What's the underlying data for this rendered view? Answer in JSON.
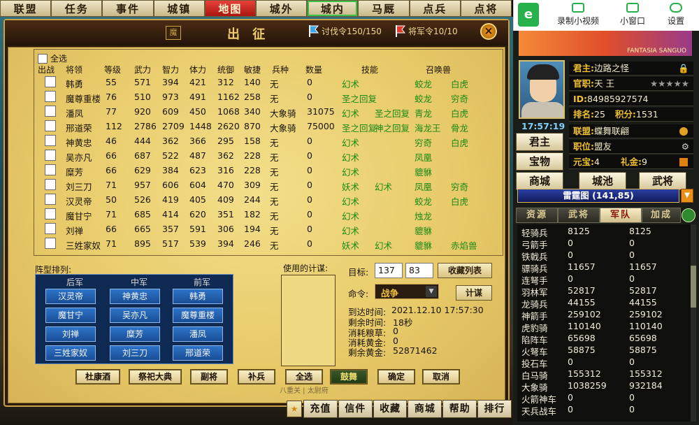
{
  "nav": [
    "联盟",
    "任务",
    "事件",
    "城镇",
    "地图",
    "城外",
    "城内",
    "马厩",
    "点兵",
    "点将"
  ],
  "panel": {
    "title": "出 征",
    "icon": "魔",
    "token1": "讨伐令150/150",
    "token2": "将军令10/10",
    "close": "×"
  },
  "table": {
    "select_all": "全选",
    "headers": [
      "出战",
      "将领",
      "等级",
      "武力",
      "智力",
      "体力",
      "统御",
      "敏捷",
      "兵种",
      "数量",
      "技能",
      "召唤兽"
    ],
    "rows": [
      {
        "name": "韩勇",
        "lv": "55",
        "wl": "571",
        "zl": "394",
        "tl": "421",
        "ty": "312",
        "mj": "140",
        "bz": "无",
        "sl": "0",
        "s1": "幻术",
        "s2": "",
        "z1": "蛟龙",
        "z2": "白虎"
      },
      {
        "name": "魔尊重楼",
        "lv": "76",
        "wl": "510",
        "zl": "973",
        "tl": "491",
        "ty": "1162",
        "mj": "258",
        "bz": "无",
        "sl": "0",
        "s1": "圣之回复",
        "s2": "",
        "z1": "蛟龙",
        "z2": "穷奇"
      },
      {
        "name": "潘凤",
        "lv": "77",
        "wl": "920",
        "zl": "609",
        "tl": "450",
        "ty": "1068",
        "mj": "340",
        "bz": "大象骑",
        "sl": "31075",
        "s1": "幻术",
        "s2": "圣之回复",
        "z1": "青龙",
        "z2": "白虎"
      },
      {
        "name": "邢道荣",
        "lv": "112",
        "wl": "2786",
        "zl": "2709",
        "tl": "1448",
        "ty": "2620",
        "mj": "870",
        "bz": "大象骑",
        "sl": "75000",
        "s1": "圣之回复",
        "s2": "神之回复",
        "z1": "海龙王",
        "z2": "骨龙"
      },
      {
        "name": "神黄忠",
        "lv": "46",
        "wl": "444",
        "zl": "362",
        "tl": "366",
        "ty": "295",
        "mj": "158",
        "bz": "无",
        "sl": "0",
        "s1": "幻术",
        "s2": "",
        "z1": "穷奇",
        "z2": "白虎"
      },
      {
        "name": "吴亦凡",
        "lv": "66",
        "wl": "687",
        "zl": "522",
        "tl": "487",
        "ty": "362",
        "mj": "228",
        "bz": "无",
        "sl": "0",
        "s1": "幻术",
        "s2": "",
        "z1": "凤凰",
        "z2": ""
      },
      {
        "name": "糜芳",
        "lv": "66",
        "wl": "629",
        "zl": "384",
        "tl": "623",
        "ty": "316",
        "mj": "228",
        "bz": "无",
        "sl": "0",
        "s1": "幻术",
        "s2": "",
        "z1": "貔貅",
        "z2": ""
      },
      {
        "name": "刘三刀",
        "lv": "71",
        "wl": "957",
        "zl": "606",
        "tl": "604",
        "ty": "470",
        "mj": "309",
        "bz": "无",
        "sl": "0",
        "s1": "妖术",
        "s2": "幻术",
        "z1": "凤凰",
        "z2": "穷奇"
      },
      {
        "name": "汉灵帝",
        "lv": "50",
        "wl": "526",
        "zl": "419",
        "tl": "405",
        "ty": "409",
        "mj": "244",
        "bz": "无",
        "sl": "0",
        "s1": "幻术",
        "s2": "",
        "z1": "蛟龙",
        "z2": "白虎"
      },
      {
        "name": "魔甘宁",
        "lv": "71",
        "wl": "685",
        "zl": "414",
        "tl": "620",
        "ty": "351",
        "mj": "182",
        "bz": "无",
        "sl": "0",
        "s1": "幻术",
        "s2": "",
        "z1": "烛龙",
        "z2": ""
      },
      {
        "name": "刘禅",
        "lv": "66",
        "wl": "665",
        "zl": "357",
        "tl": "591",
        "ty": "306",
        "mj": "194",
        "bz": "无",
        "sl": "0",
        "s1": "幻术",
        "s2": "",
        "z1": "貔貅",
        "z2": ""
      },
      {
        "name": "三姓家奴",
        "lv": "71",
        "wl": "895",
        "zl": "517",
        "tl": "539",
        "ty": "394",
        "mj": "246",
        "bz": "无",
        "sl": "0",
        "s1": "妖术",
        "s2": "幻术",
        "z1": "貔貅",
        "z2": "赤焰兽"
      }
    ]
  },
  "formation": {
    "label": "阵型排列:",
    "cols": [
      "后军",
      "中军",
      "前军"
    ],
    "back": [
      "汉灵帝",
      "魔甘宁",
      "刘禅",
      "三姓家奴"
    ],
    "mid": [
      "神黄忠",
      "吴亦凡",
      "糜芳",
      "刘三刀"
    ],
    "front": [
      "韩勇",
      "魔尊重楼",
      "潘凤",
      "邢道荣"
    ]
  },
  "strategy": {
    "label": "使用的计谋:"
  },
  "target": {
    "label": "目标:",
    "x": "137",
    "y": "83",
    "fav": "收藏列表"
  },
  "command": {
    "label": "命令:",
    "value": "战争",
    "plan": "计谋"
  },
  "info": {
    "arrive_label": "到达时间:",
    "arrive": "2021.12.10   17:57:30",
    "remain_label": "剩余时间:",
    "remain": "18秒",
    "food_label": "消耗粮草:",
    "food": "0",
    "gold_label": "消耗黄金:",
    "gold": "0",
    "left_label": "剩余黄金:",
    "left": "52871462"
  },
  "buttons": [
    "杜康酒",
    "祭祀大典",
    "副将",
    "补兵",
    "全选",
    "鼓舞",
    "确定",
    "取消"
  ],
  "bottom": [
    "充值",
    "信件",
    "收藏",
    "商城",
    "帮助",
    "排行"
  ],
  "strip": "八重关 | 太尉府",
  "client": {
    "video": "录制小视频",
    "mini": "小窗口",
    "settings": "设置",
    "banner": "FANTASIA SANGUO"
  },
  "player": {
    "clock": "17:57:19",
    "lord_k": "君主:",
    "lord": "边路之怪",
    "rank_k": "官职:",
    "rank": "天 王",
    "stars": "★★★★★",
    "id_k": "ID:",
    "id": "84985927574",
    "pos_k": "排名:",
    "pos": "25",
    "score_k": "积分:",
    "score": "1531",
    "league_k": "联盟:",
    "league": "蝶舞联翩",
    "duty_k": "职位:",
    "duty": "盟友",
    "ingot_k": "元宝:",
    "ingot": "4",
    "gift_k": "礼金:",
    "gift": "9"
  },
  "sidebtns": [
    "君主",
    "宝物",
    "商城",
    "城池",
    "武将"
  ],
  "location": "雷霆图 (141,85)",
  "sidetabs": [
    "资源",
    "武将",
    "军队",
    "加成"
  ],
  "troops": [
    [
      "轻骑兵",
      "8125",
      "8125"
    ],
    [
      "弓箭手",
      "0",
      "0"
    ],
    [
      "铁戟兵",
      "0",
      "0"
    ],
    [
      "骠骑兵",
      "11657",
      "11657"
    ],
    [
      "连弩手",
      "0",
      "0"
    ],
    [
      "羽林军",
      "52817",
      "52817"
    ],
    [
      "龙骑兵",
      "44155",
      "44155"
    ],
    [
      "神箭手",
      "259102",
      "259102"
    ],
    [
      "虎豹骑",
      "110140",
      "110140"
    ],
    [
      "陷阵车",
      "65698",
      "65698"
    ],
    [
      "火弩车",
      "58875",
      "58875"
    ],
    [
      "投石车",
      "0",
      "0"
    ],
    [
      "白马骑",
      "155312",
      "155312"
    ],
    [
      "大象骑",
      "1038259",
      "932184"
    ],
    [
      "火箭神车",
      "0",
      "0"
    ],
    [
      "天兵战车",
      "0",
      "0"
    ]
  ]
}
